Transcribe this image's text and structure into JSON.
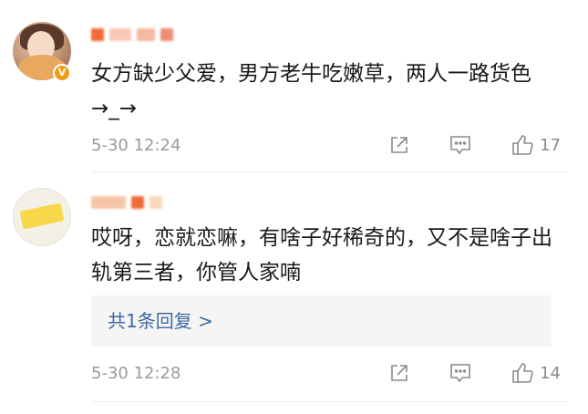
{
  "comments": [
    {
      "text": "女方缺少父爱，男方老牛吃嫩草，两人一路货色→_→",
      "time": "5-30 12:24",
      "likes": "17",
      "verified_badge": "V",
      "username_blur_colors": [
        "#f26b3a",
        "#f6c9b4",
        "#f5b8a0",
        "#f08c72"
      ]
    },
    {
      "text": "哎呀，恋就恋嘛，有啥子好稀奇的，又不是啥子出轨第三者，你管人家喃",
      "time": "5-30 12:28",
      "likes": "14",
      "reply_summary": "共1条回复 >",
      "username_blur_colors": [
        "#f6c6a6",
        "#f26b3a",
        "#f8d8b8"
      ]
    }
  ],
  "colors": {
    "link": "#3d6aa1",
    "meta": "#9a9a9a",
    "icon": "#8a8a8a",
    "badge": "#f29b1a"
  }
}
